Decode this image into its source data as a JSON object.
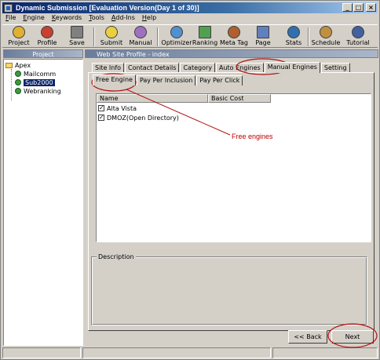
{
  "window": {
    "title": "Dynamic Submission [Evaluation Version(Day 1 of 30)]",
    "controls": {
      "minimize": "_",
      "maximize": "□",
      "close": "×"
    }
  },
  "menu": [
    "File",
    "Engine",
    "Keywords",
    "Tools",
    "Add-Ins",
    "Help"
  ],
  "toolbar": [
    {
      "label": "Project",
      "icon": "project-icon",
      "color": "#e0b030"
    },
    {
      "label": "Profile",
      "icon": "profile-icon",
      "color": "#c84030"
    },
    {
      "label": "Save",
      "icon": "save-icon",
      "color": "#808080"
    },
    {
      "label": "Submit",
      "icon": "submit-icon",
      "color": "#e8d040"
    },
    {
      "label": "Manual",
      "icon": "manual-icon",
      "color": "#a070c0"
    },
    {
      "label": "Optimizer",
      "icon": "optimizer-icon",
      "color": "#5090d0"
    },
    {
      "label": "Ranking",
      "icon": "ranking-icon",
      "color": "#50a050"
    },
    {
      "label": "Meta Tag",
      "icon": "meta-tag-icon",
      "color": "#b06030"
    },
    {
      "label": "Page",
      "icon": "page-icon",
      "color": "#6080c0"
    },
    {
      "label": "Stats",
      "icon": "stats-icon",
      "color": "#3070b0"
    },
    {
      "label": "Schedule",
      "icon": "schedule-icon",
      "color": "#c09040"
    },
    {
      "label": "Tutorial",
      "icon": "tutorial-icon",
      "color": "#4060a0"
    }
  ],
  "project_panel": {
    "header": "Project",
    "root": "Apex",
    "items": [
      "Mailcomm",
      "Sub2000",
      "Webranking"
    ],
    "selected": "Sub2000"
  },
  "profile_panel": {
    "header": "Web Site Profile - index",
    "tabs": [
      "Site Info",
      "Contact Details",
      "Category",
      "Auto Engines",
      "Manual Engines",
      "Setting"
    ],
    "active_tab": "Manual Engines",
    "subtabs": [
      "Free Engine",
      "Pay Per Inclusion",
      "Pay Per Click"
    ],
    "active_subtab": "Free Engine",
    "columns": [
      "Name",
      "Basic Cost"
    ],
    "rows": [
      {
        "name": "Alta Vista",
        "checked": true
      },
      {
        "name": "DMOZ(Open Directory)",
        "checked": true
      }
    ],
    "description_label": "Description"
  },
  "buttons": {
    "back": "<< Back",
    "next": "Next"
  },
  "annotation": {
    "text": "Free engines",
    "color": "#c00000"
  }
}
